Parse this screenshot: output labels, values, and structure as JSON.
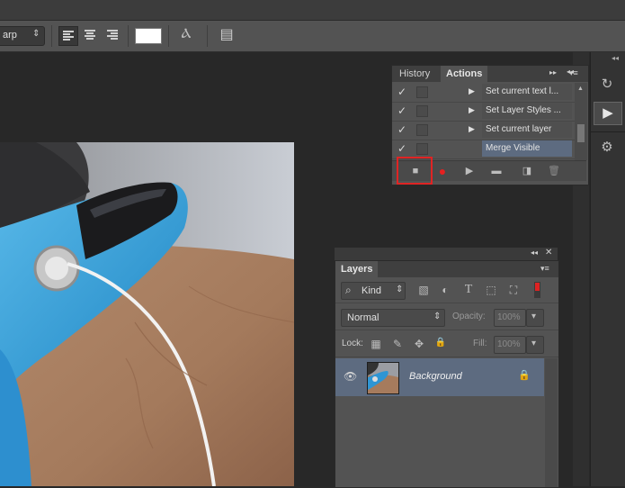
{
  "options_bar": {
    "antialias_value": "arp",
    "antialias_arrow": "⇕",
    "warp_glyph": "Ⲁ",
    "panels_glyph": "▤"
  },
  "colors": {
    "text_color_swatch": "#ffffff",
    "selection_highlight": "#5d6b80",
    "record_red": "#e62020",
    "callout_red": "#e02424"
  },
  "actions_panel": {
    "tabs": [
      {
        "label": "History",
        "active": false
      },
      {
        "label": "Actions",
        "active": true
      }
    ],
    "header_glyphs": {
      "expand": "▸▸",
      "menu": "▾≡",
      "collapse": "◂◂",
      "close": "✕"
    },
    "rows": [
      {
        "check": "✓",
        "expand": "▶",
        "name": "Set current text l..."
      },
      {
        "check": "✓",
        "expand": "▶",
        "name": "Set Layer Styles ..."
      },
      {
        "check": "✓",
        "expand": "▶",
        "name": "Set current layer"
      },
      {
        "check": "✓",
        "expand": "",
        "name": "Merge Visible",
        "selected": true
      }
    ],
    "scroll_up": "▲",
    "buttons": {
      "stop": "■",
      "record": "●",
      "play": "▶",
      "new_set": "▬",
      "new_action": "◨",
      "delete": "🗑"
    }
  },
  "layers_panel": {
    "header_glyphs": {
      "collapse": "◂◂",
      "close": "✕",
      "menu": "▾≡"
    },
    "tab": "Layers",
    "filter_kind": "Kind",
    "filter_icons": {
      "search": "⌕",
      "pixel": "▧",
      "adjust": "◐",
      "type": "T",
      "shape": "⬚",
      "smart": "⛶"
    },
    "blend_mode": "Normal",
    "select_arrows": "⇕",
    "dropdown_arrow": "▾",
    "opacity_label": "Opacity:",
    "opacity_value": "100%",
    "lock_label": "Lock:",
    "lock_icons": {
      "pixels": "▦",
      "brush": "✎",
      "move": "✥",
      "all": "🔒"
    },
    "fill_label": "Fill:",
    "fill_value": "100%",
    "layer": {
      "name": "Background",
      "eye": "👁",
      "lock": "🔒"
    }
  },
  "right_strip": {
    "collapse": "◂◂",
    "history_glyph": "↻",
    "play_glyph": "▶",
    "props_glyph": "⚙"
  }
}
